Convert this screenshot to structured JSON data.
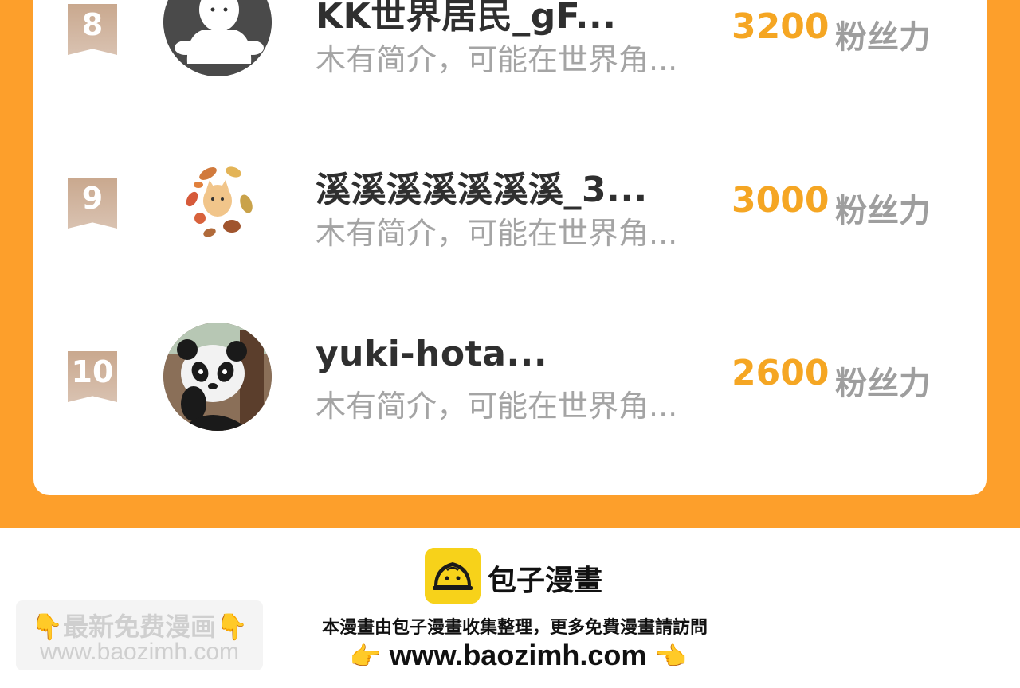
{
  "footer_brand": {
    "name": "包子漫畫",
    "credit": "本漫畫由包子漫畫收集整理，更多免費漫畫請訪問",
    "url": "www.baozimh.com"
  },
  "watermark": {
    "line1": "👇最新免费漫画👇",
    "line2": "www.baozimh.com"
  },
  "ranking": [
    {
      "rank": "8",
      "name": "KK世界居民_gF...",
      "bio": "木有简介，可能在世界角...",
      "fans": "3200",
      "unit": "粉丝力",
      "avatar": "ghost-avatar"
    },
    {
      "rank": "9",
      "name": "溪溪溪溪溪溪溪_3...",
      "bio": "木有简介，可能在世界角...",
      "fans": "3000",
      "unit": "粉丝力",
      "avatar": "autumn-cat-avatar"
    },
    {
      "rank": "10",
      "name": "yuki-hota...",
      "bio": "木有简介，可能在世界角...",
      "fans": "2600",
      "unit": "粉丝力",
      "avatar": "panda-avatar"
    }
  ],
  "colors": {
    "orange": "#fd9f2b",
    "fans_number": "#f5a623",
    "ribbon": "#c9a88e",
    "logo_yellow": "#f7d21a"
  }
}
